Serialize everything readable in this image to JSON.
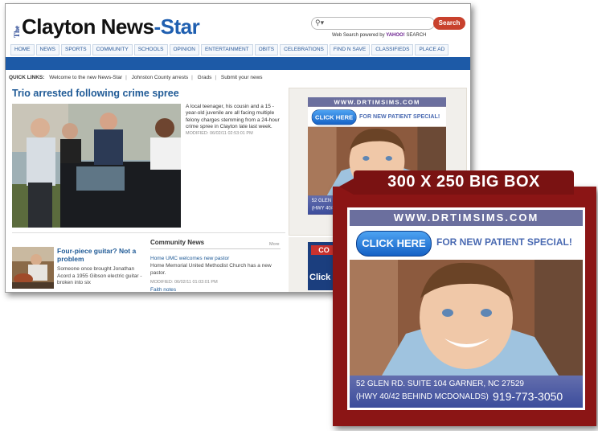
{
  "site": {
    "logo_the": "The",
    "logo_main": "Clayton News",
    "logo_dash": "-",
    "logo_star": "Star",
    "search_button": "Search",
    "search_icon": "magnifier-icon",
    "powered_prefix": "Web Search powered by ",
    "powered_yahoo": "YAHOO!",
    "powered_suffix": " SEARCH",
    "nav": [
      "HOME",
      "NEWS",
      "SPORTS",
      "COMMUNITY",
      "SCHOOLS",
      "OPINION",
      "ENTERTAINMENT",
      "OBITS",
      "CELEBRATIONS",
      "FIND N SAVE",
      "CLASSIFIEDS",
      "PLACE AD"
    ],
    "quick_links_label": "QUICK LINKS:",
    "quick_links": [
      "Welcome to the new News-Star",
      "Johnston County arrests",
      "Grads",
      "Submit your news"
    ],
    "headline": "Trio arrested following crime spree",
    "story": "A local teenager, his cousin and a 15 -year-old juvenile are all facing multiple felony charges stemming from a 24-hour crime spree in Clayton late last week.",
    "story_modified": "MODIFIED: 06/02/11 02:53:01 PM",
    "guitar_title": "Four-piece guitar? Not a problem",
    "guitar_text": "Someone once brought Jonathan Acord a 1955 Gibson electric guitar - broken into six",
    "community_title": "Community News",
    "community_more": "More",
    "community_link": "Home UMC welcomes new pastor",
    "community_text": "Home Memorial United Methodist Church has a new pastor.",
    "community_modified": "MODIFIED: 06/02/11 01:03:01 PM",
    "community_link2": "Faith notes",
    "small_ad_line1": "CO",
    "small_ad_line2": "Click"
  },
  "ad": {
    "url": "WWW.DRTIMSIMS.COM",
    "click_label": "CLICK HERE",
    "tagline": "FOR NEW PATIENT SPECIAL!",
    "address1": "52 GLEN RD. SUITE 104 GARNER, NC 27529",
    "address2": "(HWY 40/42 BEHIND MCDONALDS)",
    "phone": "919-773-3050"
  },
  "callout": {
    "title": "300 X 250 BIG BOX"
  },
  "colors": {
    "brand_blue": "#1d5aa7",
    "callout_red": "#8b1515",
    "search_red": "#c8412d"
  }
}
